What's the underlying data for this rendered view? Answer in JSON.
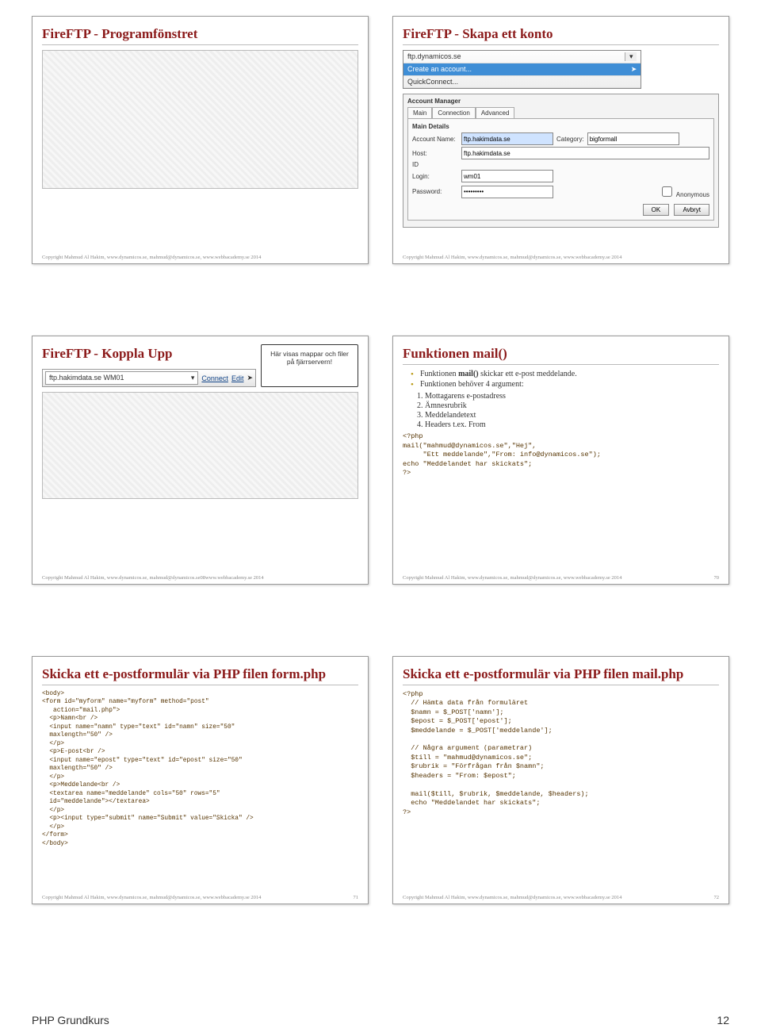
{
  "slides": {
    "s1": {
      "title": "FireFTP - Programfönstret",
      "copyright": "Copyright Mahmud Al Hakim, www.dynamicos.se, mahmud@dynamicos.se, www.webbacademy.se 2014"
    },
    "s2": {
      "title": "FireFTP - Skapa ett konto",
      "dropdown": {
        "opt1": "ftp.dynamicos.se",
        "opt_sel": "Create an account...",
        "opt3": "QuickConnect..."
      },
      "panel": {
        "top": "Account Manager",
        "tab1": "Main",
        "tab2": "Connection",
        "tab3": "Advanced",
        "section": "Main Details",
        "lbl_acc": "Account Name:",
        "val_acc": "ftp.hakimdata.se",
        "lbl_cat": "Category:",
        "val_cat": "bigformall",
        "lbl_host": "Host:",
        "val_host": "ftp.hakimdata.se",
        "lbl_id": "ID",
        "lbl_login": "Login:",
        "val_login": "wm01",
        "lbl_pw": "Password:",
        "val_pw": "•••••••••",
        "chk_anon": "Anonymous",
        "btn_ok": "OK",
        "btn_cancel": "Avbryt"
      },
      "copyright": "Copyright Mahmud Al Hakim, www.dynamicos.se, mahmud@dynamicos.se, www.webbacademy.se 2014"
    },
    "s3": {
      "title": "FireFTP - Koppla Upp",
      "bar": {
        "host": "ftp.hakimdata.se WM01",
        "connect": "Connect",
        "edit": "Edit"
      },
      "callout": "Här visas mappar och filer på fjärrservern!",
      "copyright": "Copyright Mahmud Al Hakim, www.dynamicos.se, mahmud@dynamicos.se08www.webbacademy.se 2014"
    },
    "s4": {
      "title": "Funktionen mail()",
      "b1": "Funktionen mail() skickar ett e-post meddelande.",
      "b1b": "mail()",
      "b2": "Funktionen behöver 4 argument:",
      "ol1": "Mottagarens e-postadress",
      "ol2": "Ämnesrubrik",
      "ol3": "Meddelandetext",
      "ol4": "Headers t.ex. From",
      "code": "<?php\nmail(\"mahmud@dynamicos.se\",\"Hej\",\n     \"Ett meddelande\",\"From: info@dynamicos.se\");\necho \"Meddelandet har skickats\";\n?>",
      "copyright": "Copyright Mahmud Al Hakim, www.dynamicos.se, mahmud@dynamicos.se, www.webbacademy.se 2014",
      "page": "70"
    },
    "s5": {
      "title": "Skicka ett e-postformulär via PHP filen form.php",
      "code": "<body>\n<form id=\"myform\" name=\"myform\" method=\"post\"\n   action=\"mail.php\">\n  <p>Namn<br />\n  <input name=\"namn\" type=\"text\" id=\"namn\" size=\"50\"\n  maxlength=\"50\" />\n  </p>\n  <p>E-post<br />\n  <input name=\"epost\" type=\"text\" id=\"epost\" size=\"50\"\n  maxlength=\"50\" />\n  </p>\n  <p>Meddelande<br />\n  <textarea name=\"meddelande\" cols=\"50\" rows=\"5\"\n  id=\"meddelande\"></textarea>\n  </p>\n  <p><input type=\"submit\" name=\"Submit\" value=\"Skicka\" />\n  </p>\n</form>\n</body>",
      "copyright": "Copyright Mahmud Al Hakim, www.dynamicos.se, mahmud@dynamicos.se, www.webbacademy.se 2014",
      "page": "71"
    },
    "s6": {
      "title": "Skicka ett e-postformulär via PHP filen mail.php",
      "code": "<?php\n  // Hämta data från formuläret\n  $namn = $_POST['namn'];\n  $epost = $_POST['epost'];\n  $meddelande = $_POST['meddelande'];\n\n  // Några argument (parametrar)\n  $till = \"mahmud@dynamicos.se\";\n  $rubrik = \"Förfrågan från $namn\";\n  $headers = \"From: $epost\";\n\n  mail($till, $rubrik, $meddelande, $headers);\n  echo \"Meddelandet har skickats\";\n?>",
      "copyright": "Copyright Mahmud Al Hakim, www.dynamicos.se, mahmud@dynamicos.se, www.webbacademy.se 2014",
      "page": "72"
    }
  },
  "footer": {
    "left": "PHP Grundkurs",
    "right": "12"
  }
}
